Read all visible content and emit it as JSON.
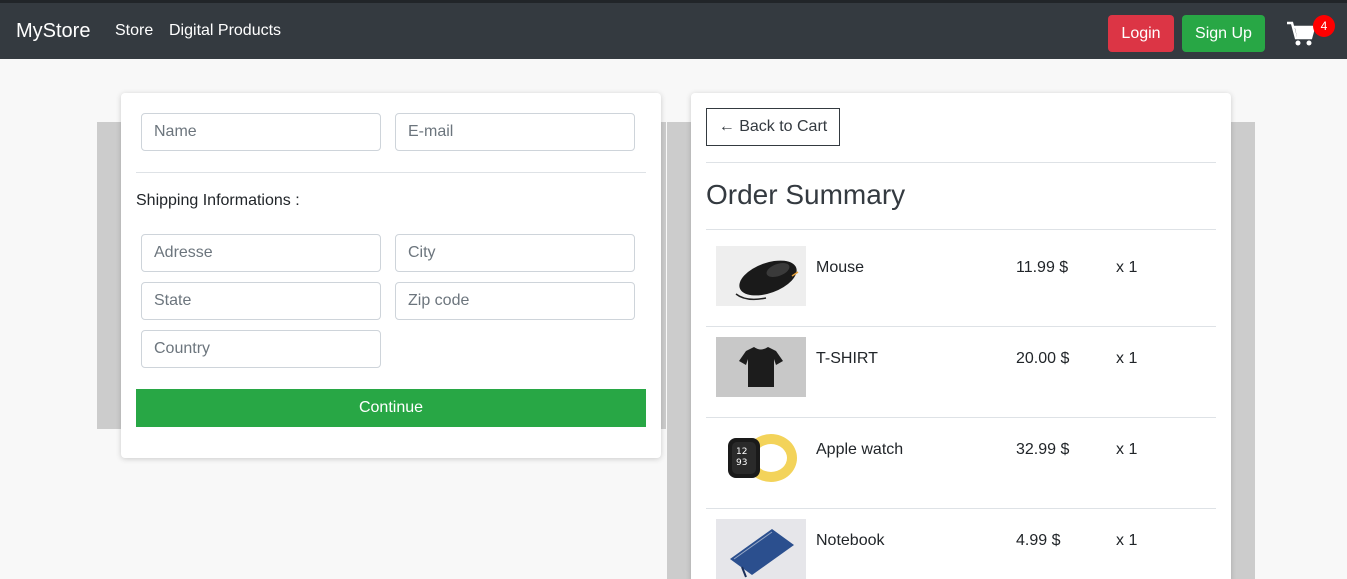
{
  "navbar": {
    "brand": "MyStore",
    "links": [
      "Store",
      "Digital Products"
    ],
    "login_label": "Login",
    "signup_label": "Sign Up",
    "cart_count": "4"
  },
  "form": {
    "name_placeholder": "Name",
    "email_placeholder": "E-mail",
    "shipping_label": "Shipping Informations :",
    "address_placeholder": "Adresse",
    "city_placeholder": "City",
    "state_placeholder": "State",
    "zip_placeholder": "Zip code",
    "country_placeholder": "Country",
    "continue_label": "Continue"
  },
  "summary": {
    "back_label": "← Back to Cart",
    "title": "Order Summary",
    "items": [
      {
        "name": "Mouse",
        "price": "11.99 $",
        "qty": "x 1",
        "icon": "mouse-image"
      },
      {
        "name": "T-SHIRT",
        "price": "20.00 $",
        "qty": "x 1",
        "icon": "tshirt-image"
      },
      {
        "name": "Apple watch",
        "price": "32.99 $",
        "qty": "x 1",
        "icon": "watch-image"
      },
      {
        "name": "Notebook",
        "price": "4.99 $",
        "qty": "x 1",
        "icon": "notebook-image"
      }
    ]
  },
  "colors": {
    "navbar": "#343a40",
    "login": "#dc3545",
    "signup": "#28a745",
    "continue": "#28a745",
    "badge": "#ff0000"
  }
}
